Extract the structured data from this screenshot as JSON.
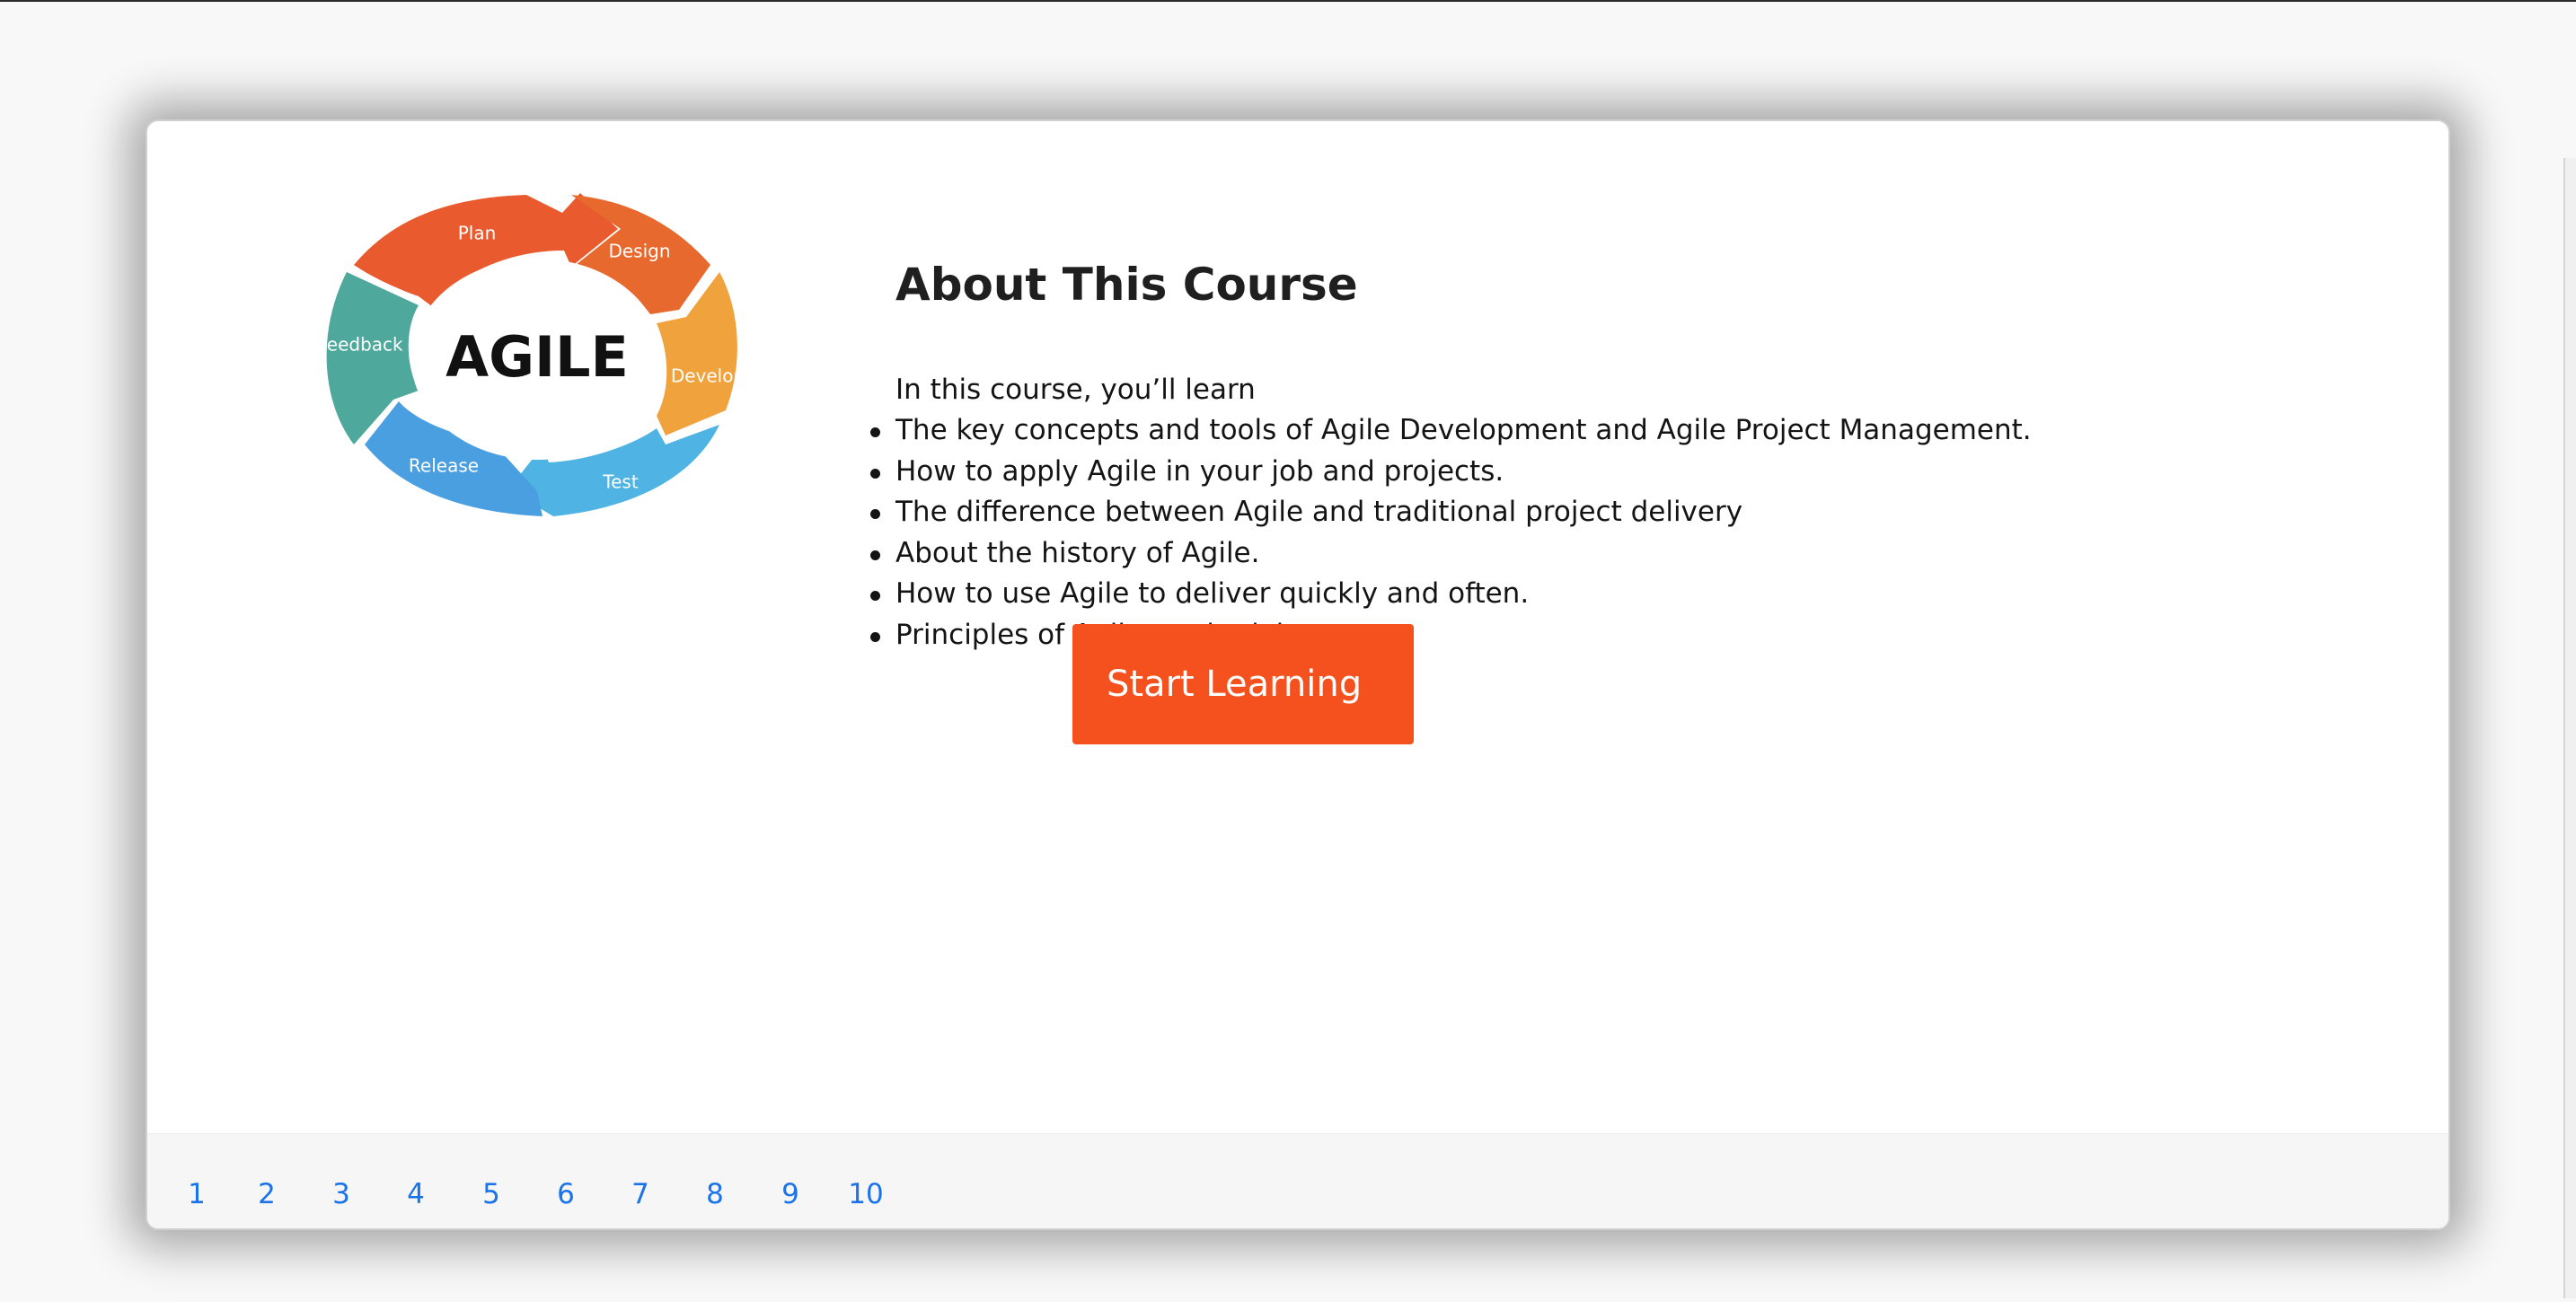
{
  "course": {
    "title": "About This Course",
    "intro": "In this course, you’ll learn",
    "outcomes": [
      "The key concepts and tools of Agile Development and Agile Project Management.",
      "How to apply Agile in your job and projects.",
      "The difference between Agile and traditional project delivery",
      "About the history of Agile.",
      "How to use Agile to deliver quickly and often.",
      "Principles of Agile methodology"
    ],
    "start_button_label": "Start Learning"
  },
  "agile_graphic": {
    "center_word": "AGILE",
    "stages": [
      "Plan",
      "Design",
      "Develop",
      "Test",
      "Release",
      "Feedback"
    ],
    "colors": {
      "plan": "#e95a2e",
      "design": "#e8692e",
      "develop": "#f0a23d",
      "test": "#4fb3e3",
      "release": "#4a9fe0",
      "feedback": "#4fa89c"
    }
  },
  "pagination": {
    "pages": [
      "1",
      "2",
      "3",
      "4",
      "5",
      "6",
      "7",
      "8",
      "9",
      "10"
    ]
  },
  "colors": {
    "accent": "#f4511e",
    "link": "#1a73e8"
  }
}
